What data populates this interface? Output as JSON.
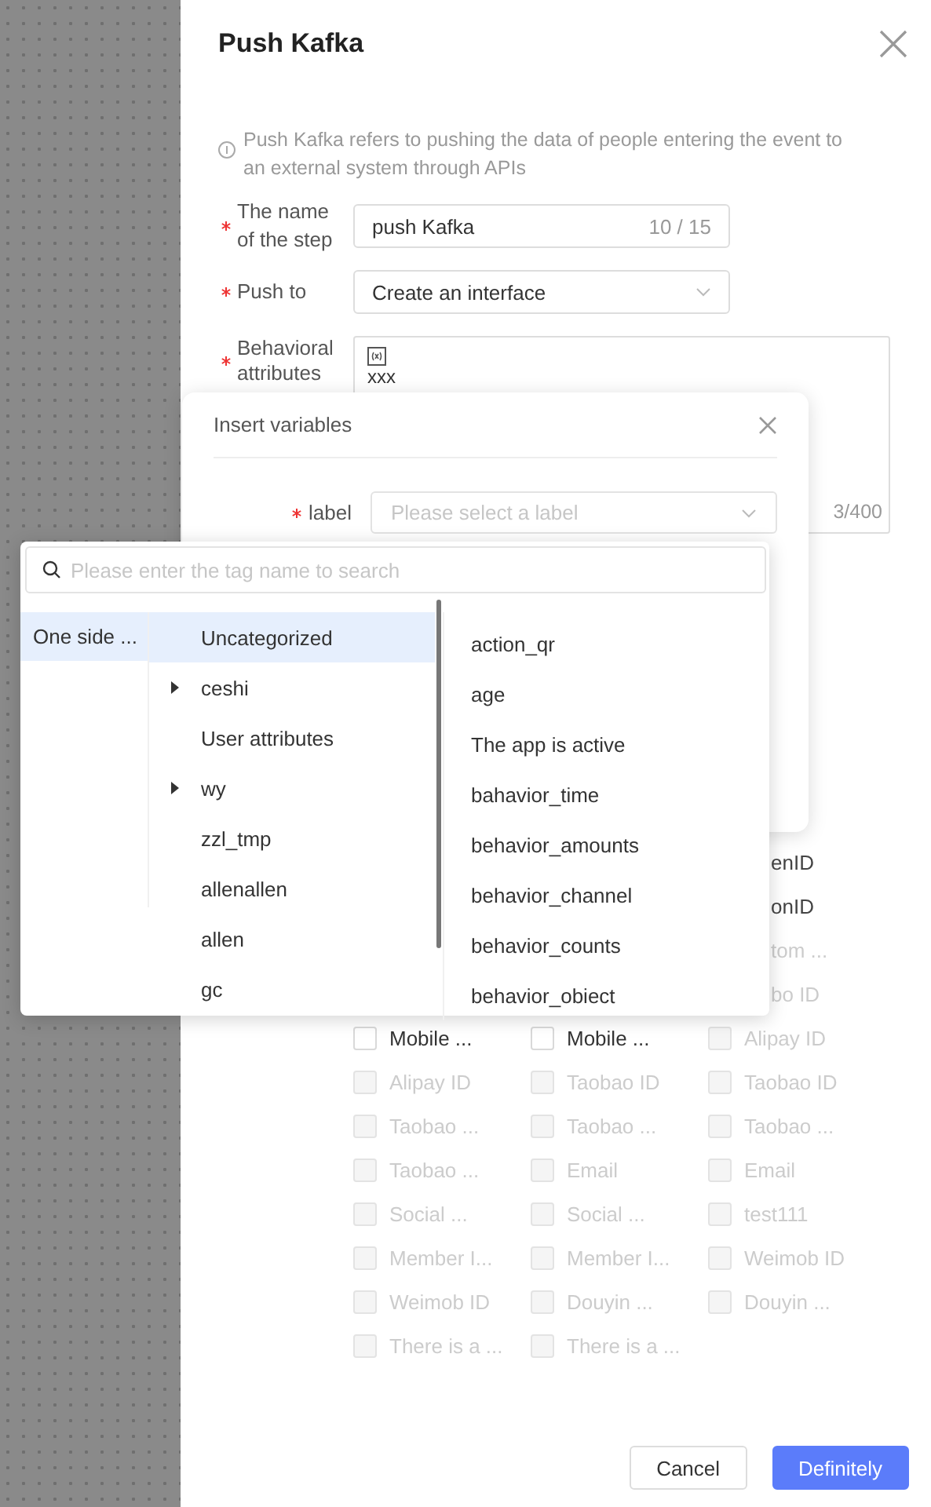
{
  "drawer": {
    "title": "Push Kafka",
    "info": "Push Kafka refers to pushing the data of people entering the event to an external system through APIs",
    "fields": [
      {
        "kind": "input",
        "label": "The name of the step",
        "required": true,
        "value": "push Kafka",
        "counter": "10 / 15"
      },
      {
        "kind": "select",
        "label": "Push to",
        "required": true,
        "value": "Create an interface"
      },
      {
        "kind": "textarea",
        "label": "Behavioral attributes",
        "required": true,
        "value": "xxx",
        "counter": "3/400"
      }
    ],
    "checkbox_rows": [
      [
        {
          "kind": "clipped",
          "label": "enID",
          "disabled": false
        }
      ],
      [
        {
          "kind": "clipped",
          "label": "onID",
          "disabled": false
        }
      ],
      [
        {
          "kind": "clipped",
          "label": "tom ...",
          "disabled": true
        }
      ],
      [
        {
          "kind": "clipped",
          "label": "bo ID",
          "disabled": true
        }
      ],
      [
        {
          "kind": "checkbox",
          "label": "Mobile ...",
          "disabled": false
        },
        {
          "kind": "checkbox",
          "label": "Mobile ...",
          "disabled": false
        },
        {
          "kind": "checkbox",
          "label": "Alipay ID",
          "disabled": true
        }
      ],
      [
        {
          "kind": "checkbox",
          "label": "Alipay ID",
          "disabled": true
        },
        {
          "kind": "checkbox",
          "label": "Taobao ID",
          "disabled": true
        },
        {
          "kind": "checkbox",
          "label": "Taobao ID",
          "disabled": true
        }
      ],
      [
        {
          "kind": "checkbox",
          "label": "Taobao ...",
          "disabled": true
        },
        {
          "kind": "checkbox",
          "label": "Taobao ...",
          "disabled": true
        },
        {
          "kind": "checkbox",
          "label": "Taobao ...",
          "disabled": true
        }
      ],
      [
        {
          "kind": "checkbox",
          "label": "Taobao ...",
          "disabled": true
        },
        {
          "kind": "checkbox",
          "label": "Email",
          "disabled": true
        },
        {
          "kind": "checkbox",
          "label": "Email",
          "disabled": true
        }
      ],
      [
        {
          "kind": "checkbox",
          "label": "Social ...",
          "disabled": true
        },
        {
          "kind": "checkbox",
          "label": "Social ...",
          "disabled": true
        },
        {
          "kind": "checkbox",
          "label": "test111",
          "disabled": true
        }
      ],
      [
        {
          "kind": "checkbox",
          "label": "Member I...",
          "disabled": true
        },
        {
          "kind": "checkbox",
          "label": "Member I...",
          "disabled": true
        },
        {
          "kind": "checkbox",
          "label": "Weimob ID",
          "disabled": true
        }
      ],
      [
        {
          "kind": "checkbox",
          "label": "Weimob ID",
          "disabled": true
        },
        {
          "kind": "checkbox",
          "label": "Douyin ...",
          "disabled": true
        },
        {
          "kind": "checkbox",
          "label": "Douyin ...",
          "disabled": true
        }
      ],
      [
        {
          "kind": "checkbox",
          "label": "There is a ...",
          "disabled": true
        },
        {
          "kind": "checkbox",
          "label": "There is a ...",
          "disabled": true
        }
      ]
    ],
    "buttons": [
      {
        "kind": "default",
        "label": "Cancel"
      },
      {
        "kind": "primary",
        "label": "Definitely"
      }
    ]
  },
  "modal": {
    "title": "Insert variables",
    "field": {
      "label": "label",
      "required": true,
      "placeholder": "Please select a label"
    }
  },
  "dropdown": {
    "search_placeholder": "Please enter the tag name to search",
    "groups": [
      {
        "label": "One side ...",
        "selected": true
      }
    ],
    "categories": [
      {
        "label": "Uncategorized",
        "has_children": false,
        "selected": true
      },
      {
        "label": "ceshi",
        "has_children": true,
        "selected": false
      },
      {
        "label": "User attributes",
        "has_children": false,
        "selected": false
      },
      {
        "label": "wy",
        "has_children": true,
        "selected": false
      },
      {
        "label": "zzl_tmp",
        "has_children": false,
        "selected": false
      },
      {
        "label": "allenallen",
        "has_children": false,
        "selected": false
      },
      {
        "label": "allen",
        "has_children": false,
        "selected": false
      },
      {
        "label": "gc",
        "has_children": false,
        "selected": false
      }
    ],
    "tags": [
      "action_qr",
      "age",
      "The app is active",
      "bahavior_time",
      "behavior_amounts",
      "behavior_channel",
      "behavior_counts",
      "behavior_obiect"
    ]
  }
}
